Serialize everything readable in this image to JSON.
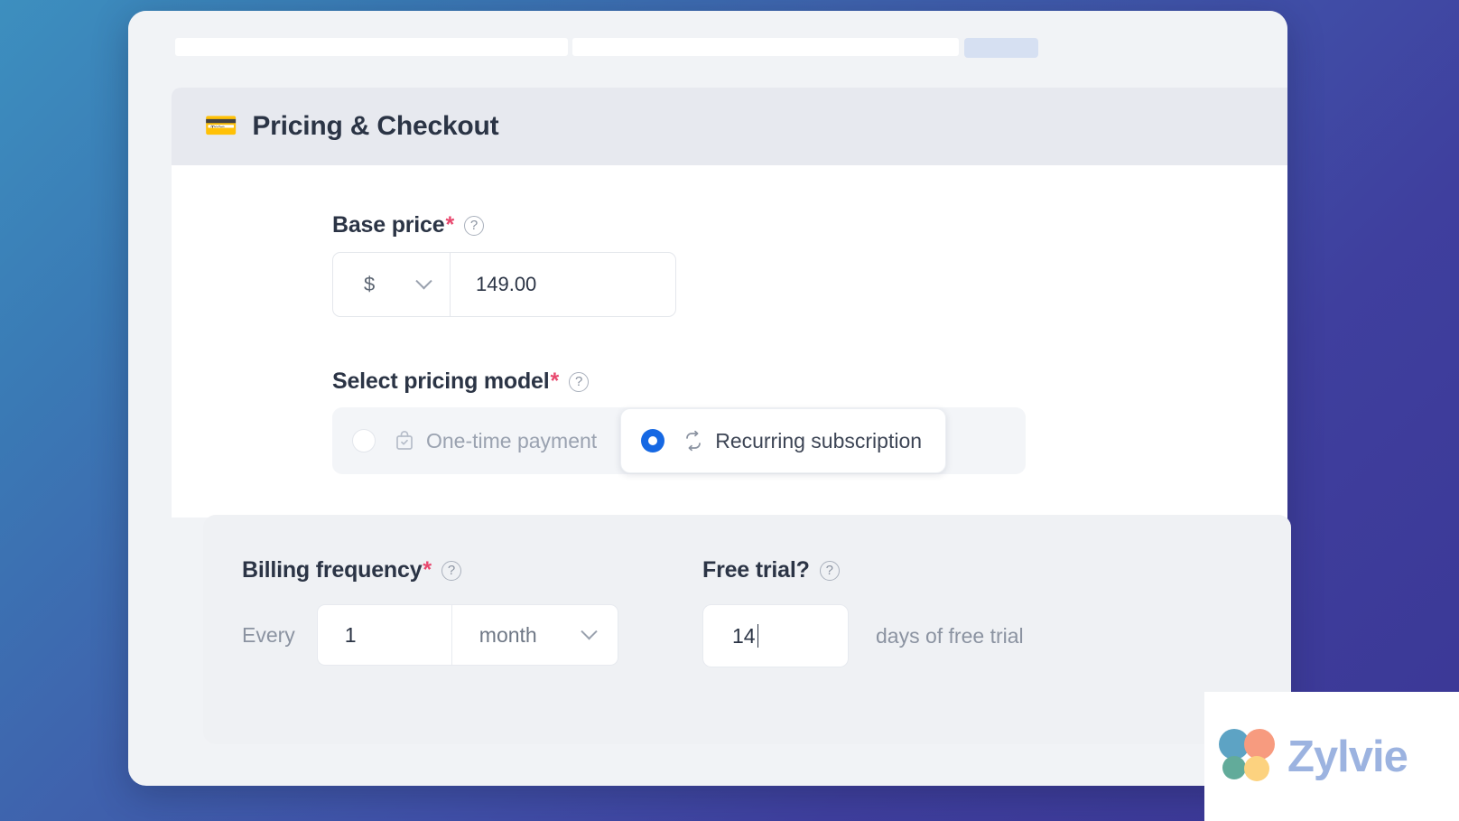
{
  "section": {
    "icon": "credit-card-emoji",
    "icon_glyph": "💳",
    "title": "Pricing & Checkout"
  },
  "base_price": {
    "label": "Base price",
    "required_mark": "*",
    "help_glyph": "?",
    "currency": "$",
    "value": "149.00"
  },
  "pricing_model": {
    "label": "Select pricing model",
    "required_mark": "*",
    "help_glyph": "?",
    "options": [
      {
        "label": "One-time payment",
        "icon": "shopping-bag-check-icon",
        "selected": false
      },
      {
        "label": "Recurring subscription",
        "icon": "repeat-icon",
        "selected": true
      }
    ]
  },
  "billing_frequency": {
    "label": "Billing frequency",
    "required_mark": "*",
    "help_glyph": "?",
    "prefix": "Every",
    "interval": "1",
    "unit": "month"
  },
  "free_trial": {
    "label": "Free trial?",
    "help_glyph": "?",
    "days": "14",
    "suffix": "days of free trial"
  },
  "watermark": {
    "brand": "Zylvie"
  },
  "colors": {
    "accent_blue": "#1668e3",
    "required_pink": "#e8486e",
    "heading_navy": "#2b3445",
    "panel_gray": "#eff1f4",
    "header_gray": "#e7e9ef",
    "brand_text": "#9cb3e0",
    "petal_blue": "#5da3c4",
    "petal_salmon": "#f79b7f",
    "petal_green": "#62ab9a",
    "petal_yellow": "#fcd27f"
  }
}
